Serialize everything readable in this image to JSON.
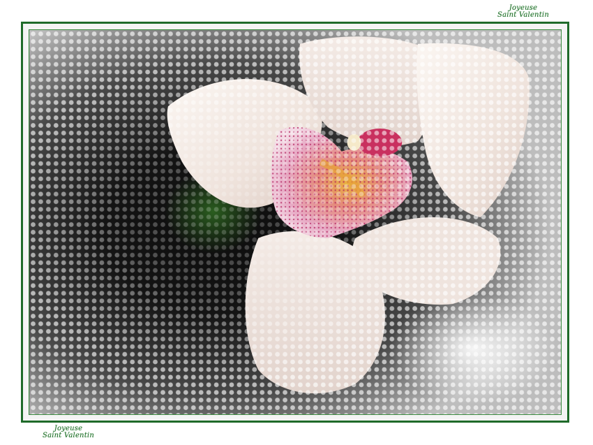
{
  "signature_top": {
    "line1": "Joyeuse",
    "line2": "Saint Valentin"
  },
  "signature_bottom": {
    "line1": "Joyeuse",
    "line2": "Saint Valentin"
  },
  "colors": {
    "frame_green": "#1f6b2a",
    "petal_white": "#f7efe9",
    "lip_pink": "#d9588f",
    "lip_spots": "#b01a5a",
    "throat_yellow": "#e8b43a",
    "background_dark": "#141414"
  },
  "image": {
    "subject": "white-orchid-with-pink-spotted-lip",
    "effect": "halftone-dot-screen"
  }
}
